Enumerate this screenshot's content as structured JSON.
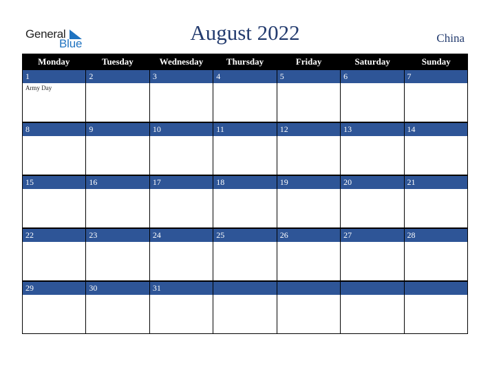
{
  "logo": {
    "general": "General",
    "blue": "Blue",
    "accent_color": "#1f73c0"
  },
  "header": {
    "title": "August 2022",
    "country": "China"
  },
  "colors": {
    "band": "#2e5597",
    "title": "#233b6e",
    "weekday_bar": "#000000"
  },
  "weekdays": [
    "Monday",
    "Tuesday",
    "Wednesday",
    "Thursday",
    "Friday",
    "Saturday",
    "Sunday"
  ],
  "weeks": [
    [
      {
        "day": "1",
        "event": "Army Day"
      },
      {
        "day": "2",
        "event": ""
      },
      {
        "day": "3",
        "event": ""
      },
      {
        "day": "4",
        "event": ""
      },
      {
        "day": "5",
        "event": ""
      },
      {
        "day": "6",
        "event": ""
      },
      {
        "day": "7",
        "event": ""
      }
    ],
    [
      {
        "day": "8",
        "event": ""
      },
      {
        "day": "9",
        "event": ""
      },
      {
        "day": "10",
        "event": ""
      },
      {
        "day": "11",
        "event": ""
      },
      {
        "day": "12",
        "event": ""
      },
      {
        "day": "13",
        "event": ""
      },
      {
        "day": "14",
        "event": ""
      }
    ],
    [
      {
        "day": "15",
        "event": ""
      },
      {
        "day": "16",
        "event": ""
      },
      {
        "day": "17",
        "event": ""
      },
      {
        "day": "18",
        "event": ""
      },
      {
        "day": "19",
        "event": ""
      },
      {
        "day": "20",
        "event": ""
      },
      {
        "day": "21",
        "event": ""
      }
    ],
    [
      {
        "day": "22",
        "event": ""
      },
      {
        "day": "23",
        "event": ""
      },
      {
        "day": "24",
        "event": ""
      },
      {
        "day": "25",
        "event": ""
      },
      {
        "day": "26",
        "event": ""
      },
      {
        "day": "27",
        "event": ""
      },
      {
        "day": "28",
        "event": ""
      }
    ],
    [
      {
        "day": "29",
        "event": ""
      },
      {
        "day": "30",
        "event": ""
      },
      {
        "day": "31",
        "event": ""
      },
      {
        "day": "",
        "event": ""
      },
      {
        "day": "",
        "event": ""
      },
      {
        "day": "",
        "event": ""
      },
      {
        "day": "",
        "event": ""
      }
    ]
  ]
}
